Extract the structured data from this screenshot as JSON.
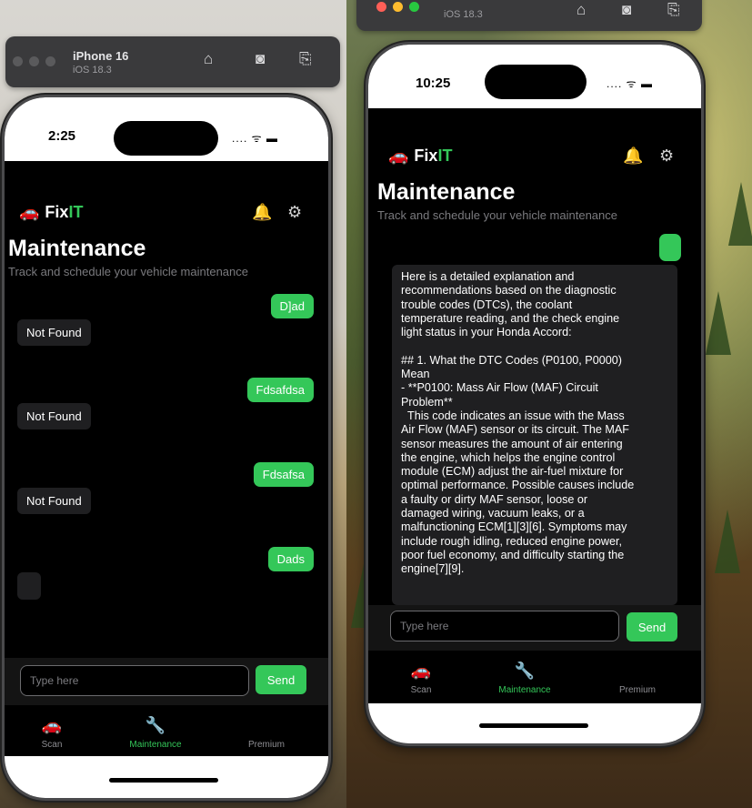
{
  "left": {
    "simulator": {
      "device": "iPhone 16",
      "os": "iOS 18.3"
    },
    "status": {
      "time": "2:25",
      "signal": ".... ᯤ ▬"
    },
    "app": {
      "brand_prefix": "Fix",
      "brand_suffix": "IT"
    },
    "page": {
      "title": "Maintenance",
      "subtitle": "Track and schedule your vehicle maintenance"
    },
    "messages": [
      {
        "role": "user",
        "text": "D]ad"
      },
      {
        "role": "bot",
        "text": "Not Found"
      },
      {
        "role": "user",
        "text": "Fdsafdsa"
      },
      {
        "role": "bot",
        "text": "Not Found"
      },
      {
        "role": "user",
        "text": "Fdsafsa"
      },
      {
        "role": "bot",
        "text": "Not Found"
      },
      {
        "role": "user",
        "text": "Dads"
      },
      {
        "role": "bot",
        "text": ""
      }
    ],
    "input": {
      "placeholder": "Type here",
      "send_label": "Send"
    },
    "tabs": [
      {
        "label": "Scan",
        "icon": "car-icon"
      },
      {
        "label": "Maintenance",
        "icon": "wrench-icon"
      },
      {
        "label": "Premium",
        "icon": "shield-icon"
      }
    ]
  },
  "right": {
    "simulator": {
      "os": "iOS 18.3"
    },
    "status": {
      "time": "10:25",
      "signal": ".... ᯤ ▬"
    },
    "app": {
      "brand_prefix": "Fix",
      "brand_suffix": "IT"
    },
    "page": {
      "title": "Maintenance",
      "subtitle": "Track and schedule your vehicle maintenance"
    },
    "user_message": "",
    "bot_message": "Here is a detailed explanation and\nrecommendations based on the diagnostic\ntrouble codes (DTCs), the coolant\ntemperature reading, and the check engine\nlight status in your Honda Accord:\n\n## 1. What the DTC Codes (P0100, P0000)\nMean\n- **P0100: Mass Air Flow (MAF) Circuit\nProblem**\n  This code indicates an issue with the Mass\nAir Flow (MAF) sensor or its circuit. The MAF\nsensor measures the amount of air entering\nthe engine, which helps the engine control\nmodule (ECM) adjust the air-fuel mixture for\noptimal performance. Possible causes include\na faulty or dirty MAF sensor, loose or\ndamaged wiring, vacuum leaks, or a\nmalfunctioning ECM[1][3][6]. Symptoms may\ninclude rough idling, reduced engine power,\npoor fuel economy, and difficulty starting the\nengine[7][9].",
    "input": {
      "placeholder": "Type here",
      "send_label": "Send"
    },
    "tabs": [
      {
        "label": "Scan",
        "icon": "car-icon"
      },
      {
        "label": "Maintenance",
        "icon": "wrench-icon"
      },
      {
        "label": "Premium",
        "icon": "shield-icon"
      }
    ]
  },
  "colors": {
    "accent": "#34c759",
    "bell": "#f5c518",
    "background": "#000000",
    "bubble": "#1f1f21"
  }
}
